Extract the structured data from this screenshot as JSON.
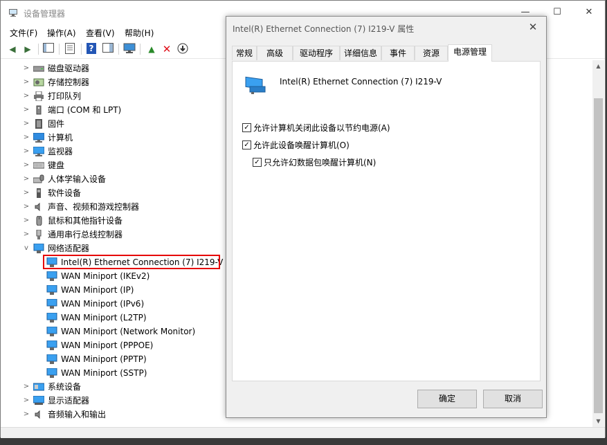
{
  "window": {
    "title": "设备管理器",
    "minimize": "—",
    "maximize": "☐",
    "close": "✕"
  },
  "menu": [
    "文件(F)",
    "操作(A)",
    "查看(V)",
    "帮助(H)"
  ],
  "tree": {
    "categories_top": [
      {
        "label": "磁盘驱动器",
        "icon": "disk-drive-icon"
      },
      {
        "label": "存储控制器",
        "icon": "storage-controller-icon"
      },
      {
        "label": "打印队列",
        "icon": "printer-icon"
      },
      {
        "label": "端口 (COM 和 LPT)",
        "icon": "port-icon"
      },
      {
        "label": "固件",
        "icon": "firmware-icon"
      },
      {
        "label": "计算机",
        "icon": "computer-icon"
      },
      {
        "label": "监视器",
        "icon": "monitor-icon"
      },
      {
        "label": "键盘",
        "icon": "keyboard-icon"
      },
      {
        "label": "人体学输入设备",
        "icon": "hid-icon"
      },
      {
        "label": "软件设备",
        "icon": "software-device-icon"
      },
      {
        "label": "声音、视频和游戏控制器",
        "icon": "sound-icon"
      },
      {
        "label": "鼠标和其他指针设备",
        "icon": "mouse-icon"
      },
      {
        "label": "通用串行总线控制器",
        "icon": "usb-icon"
      },
      {
        "label": "网络适配器",
        "icon": "network-adapter-icon",
        "expanded": true
      }
    ],
    "network_children": [
      "Intel(R) Ethernet Connection (7) I219-V",
      "WAN Miniport (IKEv2)",
      "WAN Miniport (IP)",
      "WAN Miniport (IPv6)",
      "WAN Miniport (L2TP)",
      "WAN Miniport (Network Monitor)",
      "WAN Miniport (PPPOE)",
      "WAN Miniport (PPTP)",
      "WAN Miniport (SSTP)"
    ],
    "categories_bottom": [
      {
        "label": "系统设备",
        "icon": "system-device-icon"
      },
      {
        "label": "显示适配器",
        "icon": "display-adapter-icon"
      },
      {
        "label": "音频输入和输出",
        "icon": "audio-io-icon"
      }
    ]
  },
  "dialog": {
    "title": "Intel(R) Ethernet Connection (7) I219-V 属性",
    "close": "✕",
    "tabs": [
      "常规",
      "高级",
      "驱动程序",
      "详细信息",
      "事件",
      "资源",
      "电源管理"
    ],
    "active_tab": "电源管理",
    "device_name": "Intel(R) Ethernet Connection (7) I219-V",
    "options": [
      {
        "label": "允许计算机关闭此设备以节约电源(A)",
        "checked": true
      },
      {
        "label": "允许此设备唤醒计算机(O)",
        "checked": true
      },
      {
        "label": "只允许幻数据包唤醒计算机(N)",
        "checked": true
      }
    ],
    "ok": "确定",
    "cancel": "取消"
  },
  "colors": {
    "highlight_border": "#e60000",
    "dialog_bg": "#f0f0f0"
  }
}
